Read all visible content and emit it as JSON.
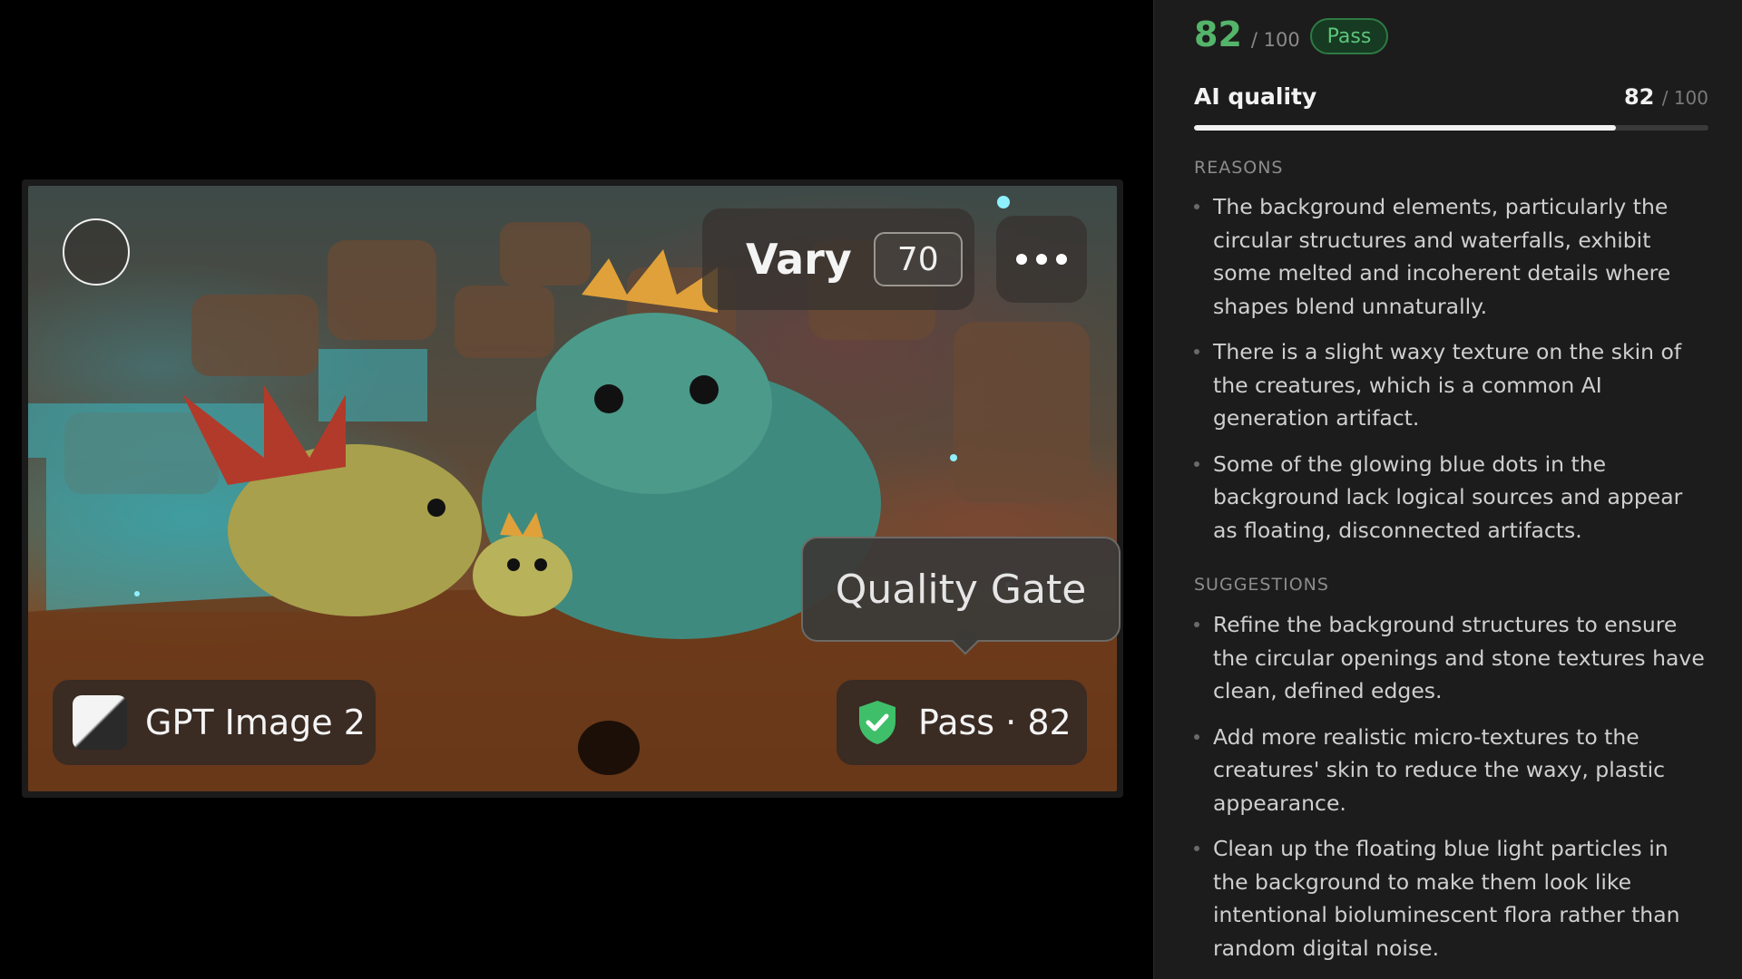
{
  "canvas": {
    "vary": {
      "label": "Vary",
      "value": "70"
    },
    "tooltip": "Quality Gate",
    "model": {
      "label": "GPT Image 2"
    },
    "pass_chip": {
      "label": "Pass · 82"
    }
  },
  "panel": {
    "score": "82",
    "score_of": "/ 100",
    "status": "Pass",
    "quality": {
      "label": "AI quality",
      "value": "82",
      "of": "/ 100",
      "fraction": 0.82
    },
    "reasons_heading": "REASONS",
    "reasons": [
      "The background elements, particularly the circular structures and waterfalls, exhibit some melted and incoherent details where shapes blend unnaturally.",
      "There is a slight waxy texture on the skin of the creatures, which is a common AI generation artifact.",
      "Some of the glowing blue dots in the background lack logical sources and appear as floating, disconnected artifacts."
    ],
    "suggestions_heading": "SUGGESTIONS",
    "suggestions": [
      "Refine the background structures to ensure the circular openings and stone textures have clean, defined edges.",
      "Add more realistic micro-textures to the creatures' skin to reduce the waxy, plastic appearance.",
      "Clean up the floating blue light particles in the background to make them look like intentional bioluminescent flora rather than random digital noise."
    ]
  },
  "colors": {
    "pass_green": "#54b46a",
    "panel_bg": "#1c1c1c",
    "progress_fill": "#f2f2f2"
  },
  "icons": [
    "more-icon",
    "model-logo-icon",
    "shield-check-icon"
  ]
}
